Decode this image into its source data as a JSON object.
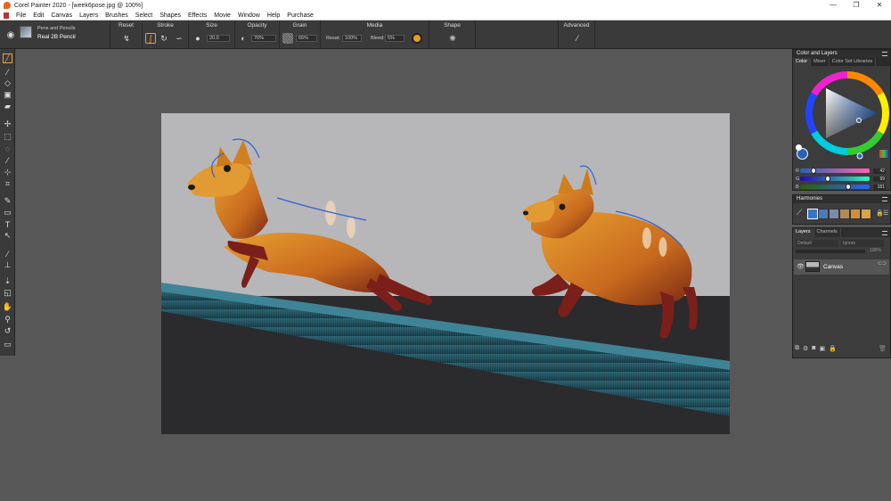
{
  "window": {
    "title": "Corel Painter 2020 - [week6pose.jpg @ 100%]",
    "controls": [
      "—",
      "❐",
      "✕"
    ]
  },
  "menu": [
    "File",
    "Edit",
    "Canvas",
    "Layers",
    "Brushes",
    "Select",
    "Shapes",
    "Effects",
    "Movie",
    "Window",
    "Help",
    "Purchase"
  ],
  "brush": {
    "category": "Pens and Pencils",
    "variant": "Real 2B Pencil"
  },
  "propbar": {
    "reset": "Reset",
    "stroke": "Stroke",
    "size": "Size",
    "size_value": "20.0",
    "opacity": "Opacity",
    "opacity_value": "70%",
    "grain": "Grain",
    "grain_value": "65%",
    "media": "Media",
    "resat_label": "Resat:",
    "resat_value": "100%",
    "bleed_label": "Bleed:",
    "bleed_value": "5%",
    "shape": "Shape",
    "advanced": "Advanced"
  },
  "color_panel": {
    "title": "Color and Layers",
    "tabs": [
      "Color",
      "Mixer",
      "Color Set Libraries"
    ],
    "active_tab": "Color",
    "current_color": "#2a62b8",
    "rgb": [
      {
        "channel": "R",
        "value": "42",
        "fraction": 0.16
      },
      {
        "channel": "G",
        "value": "99",
        "fraction": 0.39
      },
      {
        "channel": "B",
        "value": "181",
        "fraction": 0.71
      }
    ]
  },
  "harmonies": {
    "title": "Harmonies",
    "swatches": [
      "#3a72c8",
      "#4a7ab8",
      "#7e8aa4",
      "#b08a5a",
      "#d29038",
      "#d8a44c"
    ]
  },
  "layers_panel": {
    "tabs": [
      "Layers",
      "Channels"
    ],
    "active_tab": "Layers",
    "composite_method": "Default",
    "composite_depth": "Ignore",
    "opacity": "100%",
    "layers": [
      {
        "name": "Canvas",
        "visible": true,
        "selected": true
      }
    ]
  }
}
